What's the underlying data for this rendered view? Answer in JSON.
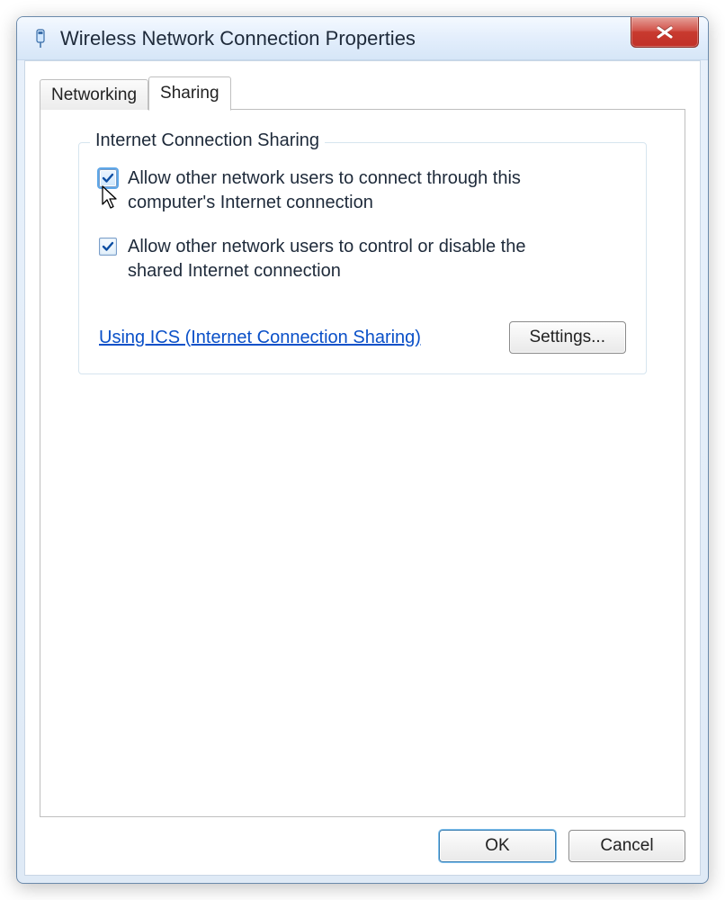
{
  "window": {
    "title": "Wireless Network Connection Properties",
    "icon": "network-adapter-icon"
  },
  "tabs": [
    {
      "label": "Networking",
      "active": false
    },
    {
      "label": "Sharing",
      "active": true
    }
  ],
  "group": {
    "title": "Internet Connection Sharing",
    "option1": {
      "label": "Allow other network users to connect through this computer's Internet connection",
      "checked": true,
      "focused": true
    },
    "option2": {
      "label": "Allow other network users to control or disable the shared Internet connection",
      "checked": true
    },
    "help_link": "Using ICS (Internet Connection Sharing)",
    "settings_button": "Settings..."
  },
  "footer": {
    "ok": "OK",
    "cancel": "Cancel"
  }
}
